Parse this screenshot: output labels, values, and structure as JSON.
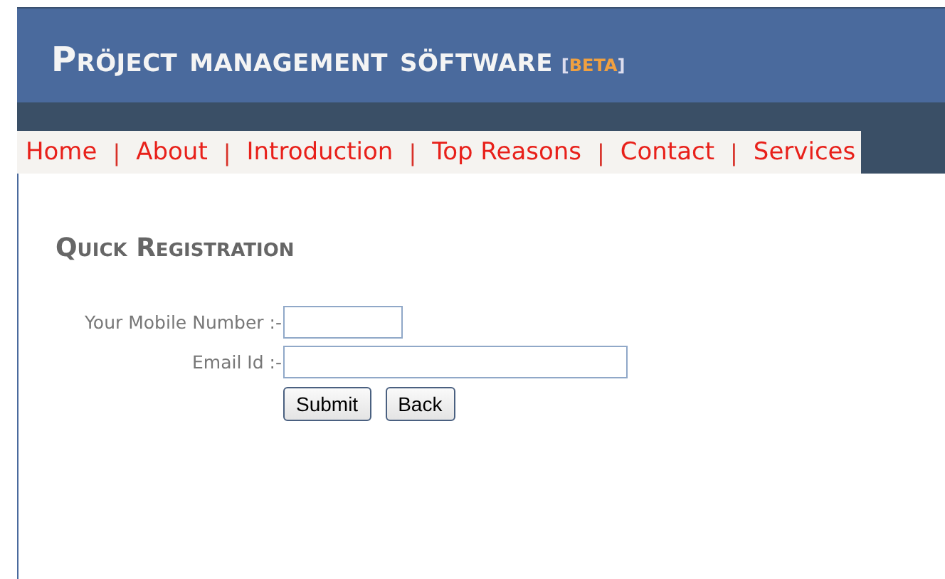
{
  "header": {
    "title": "Pröject management söftware",
    "badge_open": "[",
    "badge": "BETA",
    "badge_close": "]"
  },
  "nav": [
    {
      "kind": "link",
      "label": "Home"
    },
    {
      "kind": "separator",
      "label": "|"
    },
    {
      "kind": "link",
      "label": "About"
    },
    {
      "kind": "separator",
      "label": "|"
    },
    {
      "kind": "link",
      "label": "Introduction"
    },
    {
      "kind": "separator",
      "label": "|"
    },
    {
      "kind": "link",
      "label": "Top Reasons"
    },
    {
      "kind": "separator",
      "label": "|"
    },
    {
      "kind": "link",
      "label": "Contact"
    },
    {
      "kind": "separator",
      "label": "|"
    },
    {
      "kind": "link",
      "label": "Services"
    }
  ],
  "form": {
    "heading": "Quick Registration",
    "fields": [
      {
        "label": "Your Mobile Number :-"
      },
      {
        "label": "Email Id :-"
      }
    ],
    "buttons": [
      "Submit",
      "Back"
    ]
  }
}
